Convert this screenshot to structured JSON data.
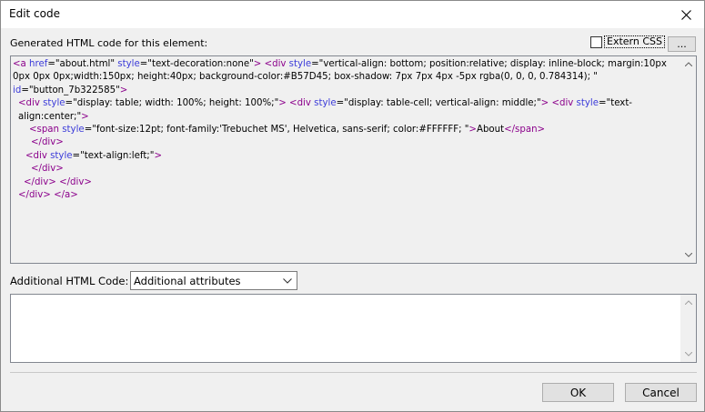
{
  "window": {
    "title": "Edit code"
  },
  "generated": {
    "label": "Generated HTML code for this element:",
    "extern_css_label": "Extern CSS",
    "extern_css_checked": false,
    "browse_label": "..."
  },
  "code": {
    "line1": {
      "t1": "<a ",
      "a1": "href",
      "v1": "=\"about.html\" ",
      "a2": "style",
      "v2": "=\"text-decoration:none\"",
      "t2": "> <div ",
      "a3": "style",
      "v3": "=\"vertical-align: bottom; position:relative; display: inline-block; margin:10px 0px 0px 0px;width:150px; height:40px; background-color:#B57D45; box-shadow: 7px 7px 4px -5px rgba(0, 0, 0, 0.784314); \" ",
      "a4": "id",
      "v4": "=\"button_7b322585\"",
      "t3": ">"
    },
    "line2": {
      "t1": "<div ",
      "a1": "style",
      "v1": "=\"display: table; width: 100%; height: 100%;\"",
      "t2": "> <div ",
      "a2": "style",
      "v2": "=\"display: table-cell; vertical-align: middle;\"",
      "t3": ">    <div ",
      "a3": "style",
      "v3": "=\"text-align:center;\"",
      "t4": ">"
    },
    "line3": {
      "t1": "<span ",
      "a1": "style",
      "v1": "=\"font-size:12pt; font-family:'Trebuchet MS', Helvetica, sans-serif; color:#FFFFFF; \"",
      "t2": ">",
      "v2": "About",
      "t3": "</span>"
    },
    "line4": "</div>",
    "line5": {
      "t1": "<div ",
      "a1": "style",
      "v1": "=\"text-align:left;\"",
      "t2": ">"
    },
    "line6": "</div>",
    "line7": "</div> </div>",
    "line8": "</div> </a>"
  },
  "additional": {
    "label": "Additional HTML Code:",
    "selected_option": "Additional attributes",
    "value": ""
  },
  "buttons": {
    "ok": "OK",
    "cancel": "Cancel"
  },
  "icons": {
    "close": "close-icon",
    "chevron": "chevron-down-icon",
    "scroll_up": "arrow-up-icon",
    "scroll_down": "arrow-down-icon"
  }
}
